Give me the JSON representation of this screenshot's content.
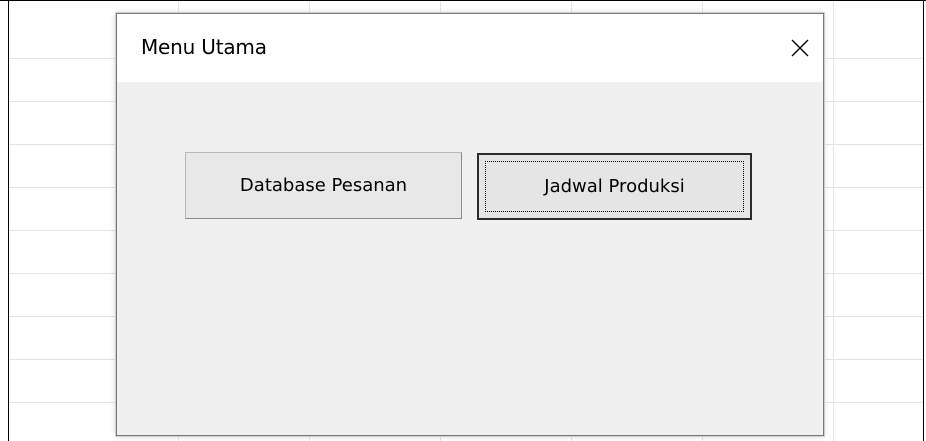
{
  "dialog": {
    "title": "Menu Utama",
    "close_icon": "close-icon"
  },
  "buttons": {
    "database_label": "Database Pesanan",
    "jadwal_label": "Jadwal Produksi"
  },
  "colors": {
    "dialog_background": "#f0f0f0",
    "titlebar_background": "#ffffff",
    "button_face": "#e1e1e1",
    "focused_button_border": "#2b2b2b"
  }
}
